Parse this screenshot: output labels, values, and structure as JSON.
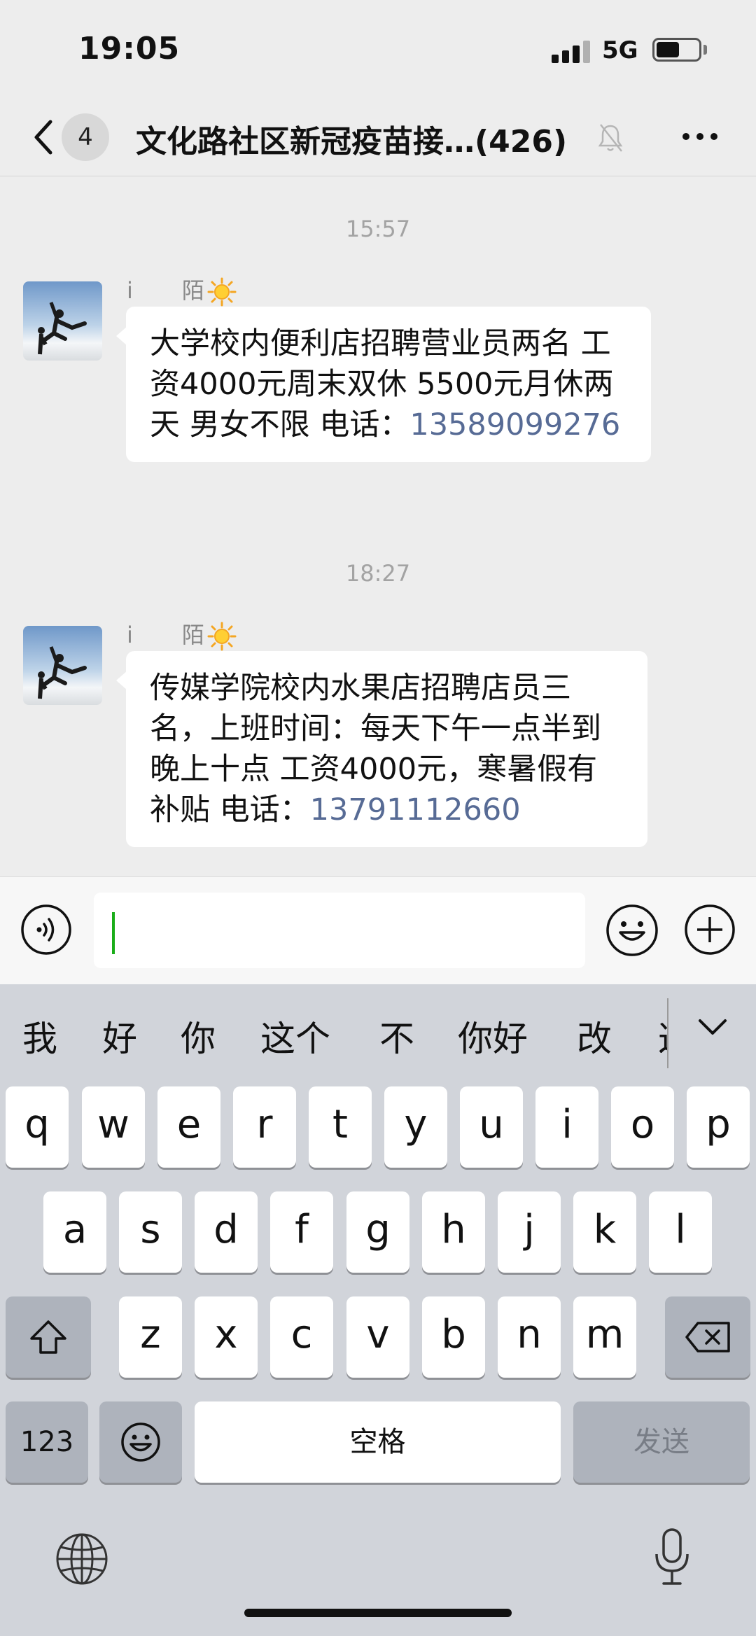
{
  "status_bar": {
    "time": "19:05",
    "network": "5G",
    "battery_level": 0.55
  },
  "nav": {
    "back_badge": "4",
    "title": "文化路社区新冠疫苗接…(426)"
  },
  "messages": [
    {
      "time": "15:57",
      "sender": {
        "name_a": "i",
        "name_b": "陌"
      },
      "text": "大学校内便利店招聘营业员两名  工资4000元周末双休   5500元月休两天  男女不限   电话：",
      "phone": "13589099276"
    },
    {
      "time": "18:27",
      "sender": {
        "name_a": "i",
        "name_b": "陌"
      },
      "text": "传媒学院校内水果店招聘店员三名，上班时间：每天下午一点半到晚上十点  工资4000元，寒暑假有补贴  电话：",
      "phone": "13791112660"
    }
  ],
  "input": {
    "value": ""
  },
  "keyboard": {
    "suggestions": [
      "我",
      "好",
      "你",
      "这个",
      "不",
      "你好",
      "改"
    ],
    "suggestion_cut": "这",
    "row1": [
      "q",
      "w",
      "e",
      "r",
      "t",
      "y",
      "u",
      "i",
      "o",
      "p"
    ],
    "row2": [
      "a",
      "s",
      "d",
      "f",
      "g",
      "h",
      "j",
      "k",
      "l"
    ],
    "row3": [
      "z",
      "x",
      "c",
      "v",
      "b",
      "n",
      "m"
    ],
    "numbers_key": "123",
    "space_key": "空格",
    "send_key": "发送"
  }
}
